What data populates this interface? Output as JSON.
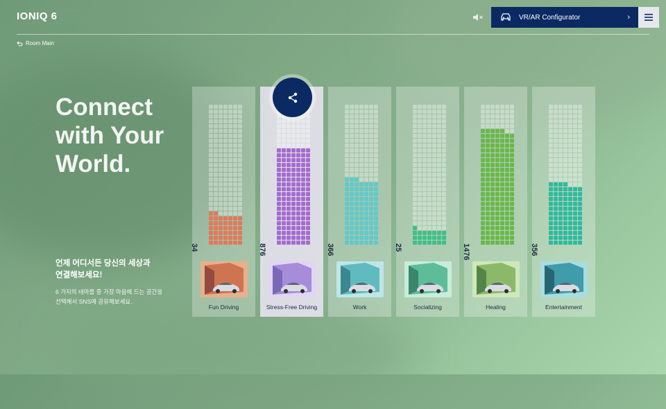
{
  "header": {
    "logo": "IONIQ 6",
    "configurator_label": "VR/AR Configurator",
    "icons": {
      "mute": "speaker-muted-icon",
      "car": "car-icon",
      "chevron": "chevron-right-icon",
      "menu": "hamburger-menu-icon"
    }
  },
  "nav": {
    "back_label": "Room Main",
    "back_icon": "return-arrow-icon"
  },
  "hero": {
    "headline_lines": [
      "Connect",
      "with Your",
      "World."
    ],
    "kr_title_lines": [
      "언제 어디서든 당신의 세상과",
      "연결해보세요!"
    ],
    "kr_desc_lines": [
      "6 가지의 테마를 중 가장 마음에 드는 공간을",
      "선택해서 SNS에 공유해보세요."
    ]
  },
  "share": {
    "icon": "share-icon"
  },
  "themes": [
    {
      "name": "Fun Driving",
      "count": "34",
      "fill_rows": 7,
      "partial": 2,
      "color": "#e07a5a",
      "active": false
    },
    {
      "name": "Stress-Free Driving",
      "count": "876",
      "fill_rows": 20,
      "partial": 0,
      "color": "#a56bd0",
      "active": true
    },
    {
      "name": "Work",
      "count": "366",
      "fill_rows": 14,
      "partial": 3,
      "color": "#63c9c9",
      "active": false
    },
    {
      "name": "Socializing",
      "count": "25",
      "fill_rows": 4,
      "partial": 1,
      "color": "#3fbf8a",
      "active": false
    },
    {
      "name": "Healing",
      "count": "1476",
      "fill_rows": 24,
      "partial": 5,
      "color": "#6ab84a",
      "active": false
    },
    {
      "name": "Entertainment",
      "count": "356",
      "fill_rows": 13,
      "partial": 4,
      "color": "#2fbaa0",
      "active": false
    }
  ]
}
